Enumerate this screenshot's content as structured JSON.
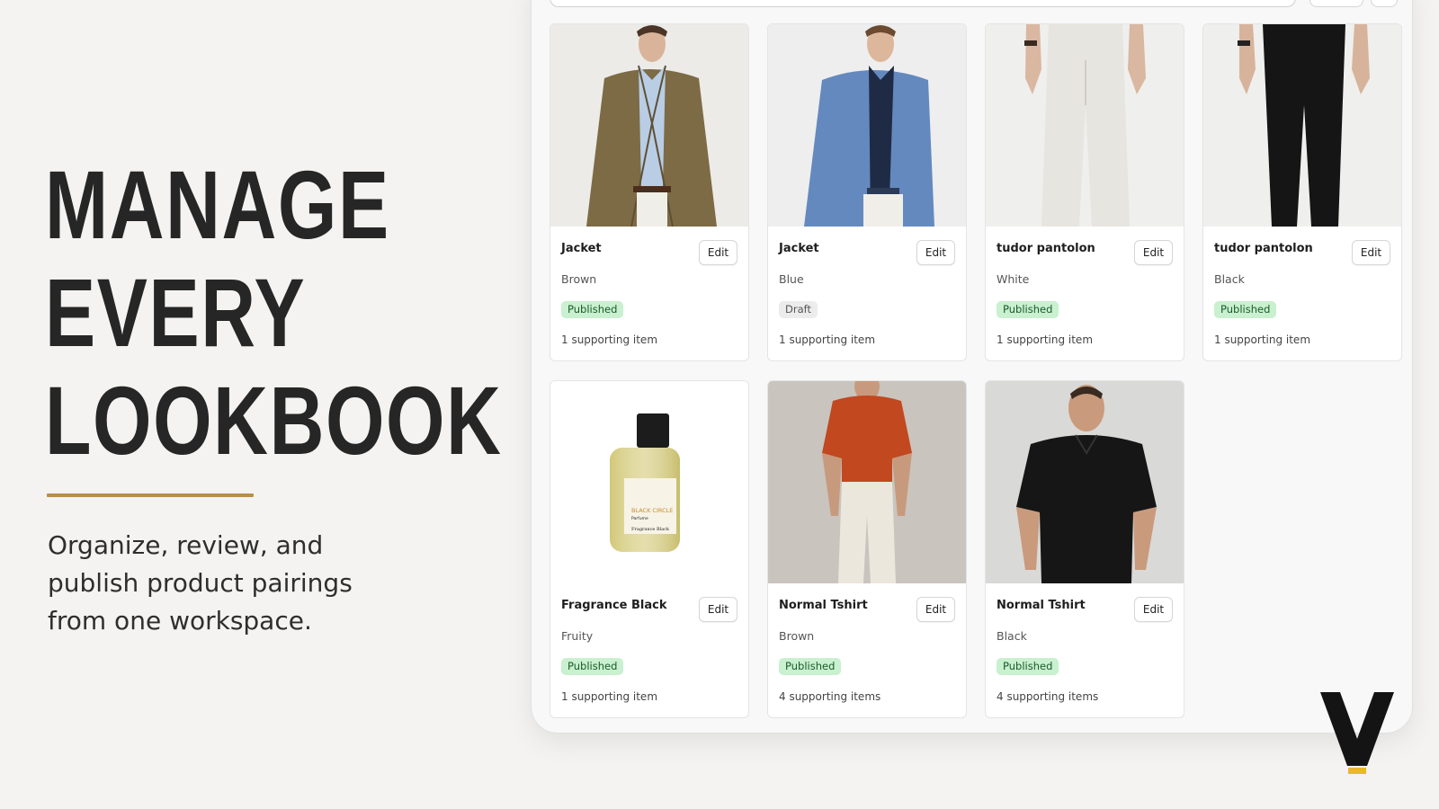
{
  "hero": {
    "lines": [
      "MANAGE",
      "EVERY",
      "LOOKBOOK"
    ],
    "subtitle": "Organize, review, and publish product pairings from one workspace."
  },
  "colors": {
    "accent_rule": "#b88d4e",
    "published_bg": "#c9f0cf",
    "draft_bg": "#ececec"
  },
  "products": [
    {
      "title": "Jacket",
      "variant": "Brown",
      "status": "Published",
      "supporting": "1 supporting item",
      "edit": "Edit",
      "image": "brown-jacket-photo"
    },
    {
      "title": "Jacket",
      "variant": "Blue",
      "status": "Draft",
      "supporting": "1 supporting item",
      "edit": "Edit",
      "image": "blue-jacket-photo"
    },
    {
      "title": "tudor pantolon",
      "variant": "White",
      "status": "Published",
      "supporting": "1 supporting item",
      "edit": "Edit",
      "image": "white-trousers-photo"
    },
    {
      "title": "tudor pantolon",
      "variant": "Black",
      "status": "Published",
      "supporting": "1 supporting item",
      "edit": "Edit",
      "image": "black-trousers-photo"
    },
    {
      "title": "Fragrance Black",
      "variant": "Fruity",
      "status": "Published",
      "supporting": "1 supporting item",
      "edit": "Edit",
      "image": "perfume-bottle-photo",
      "label": {
        "brand": "BLACK CIRCLE",
        "type": "Parfume",
        "name": "Fragrance Black"
      }
    },
    {
      "title": "Normal Tshirt",
      "variant": "Brown",
      "status": "Published",
      "supporting": "4 supporting items",
      "edit": "Edit",
      "image": "orange-polo-photo"
    },
    {
      "title": "Normal Tshirt",
      "variant": "Black",
      "status": "Published",
      "supporting": "4 supporting items",
      "edit": "Edit",
      "image": "black-polo-photo"
    }
  ]
}
